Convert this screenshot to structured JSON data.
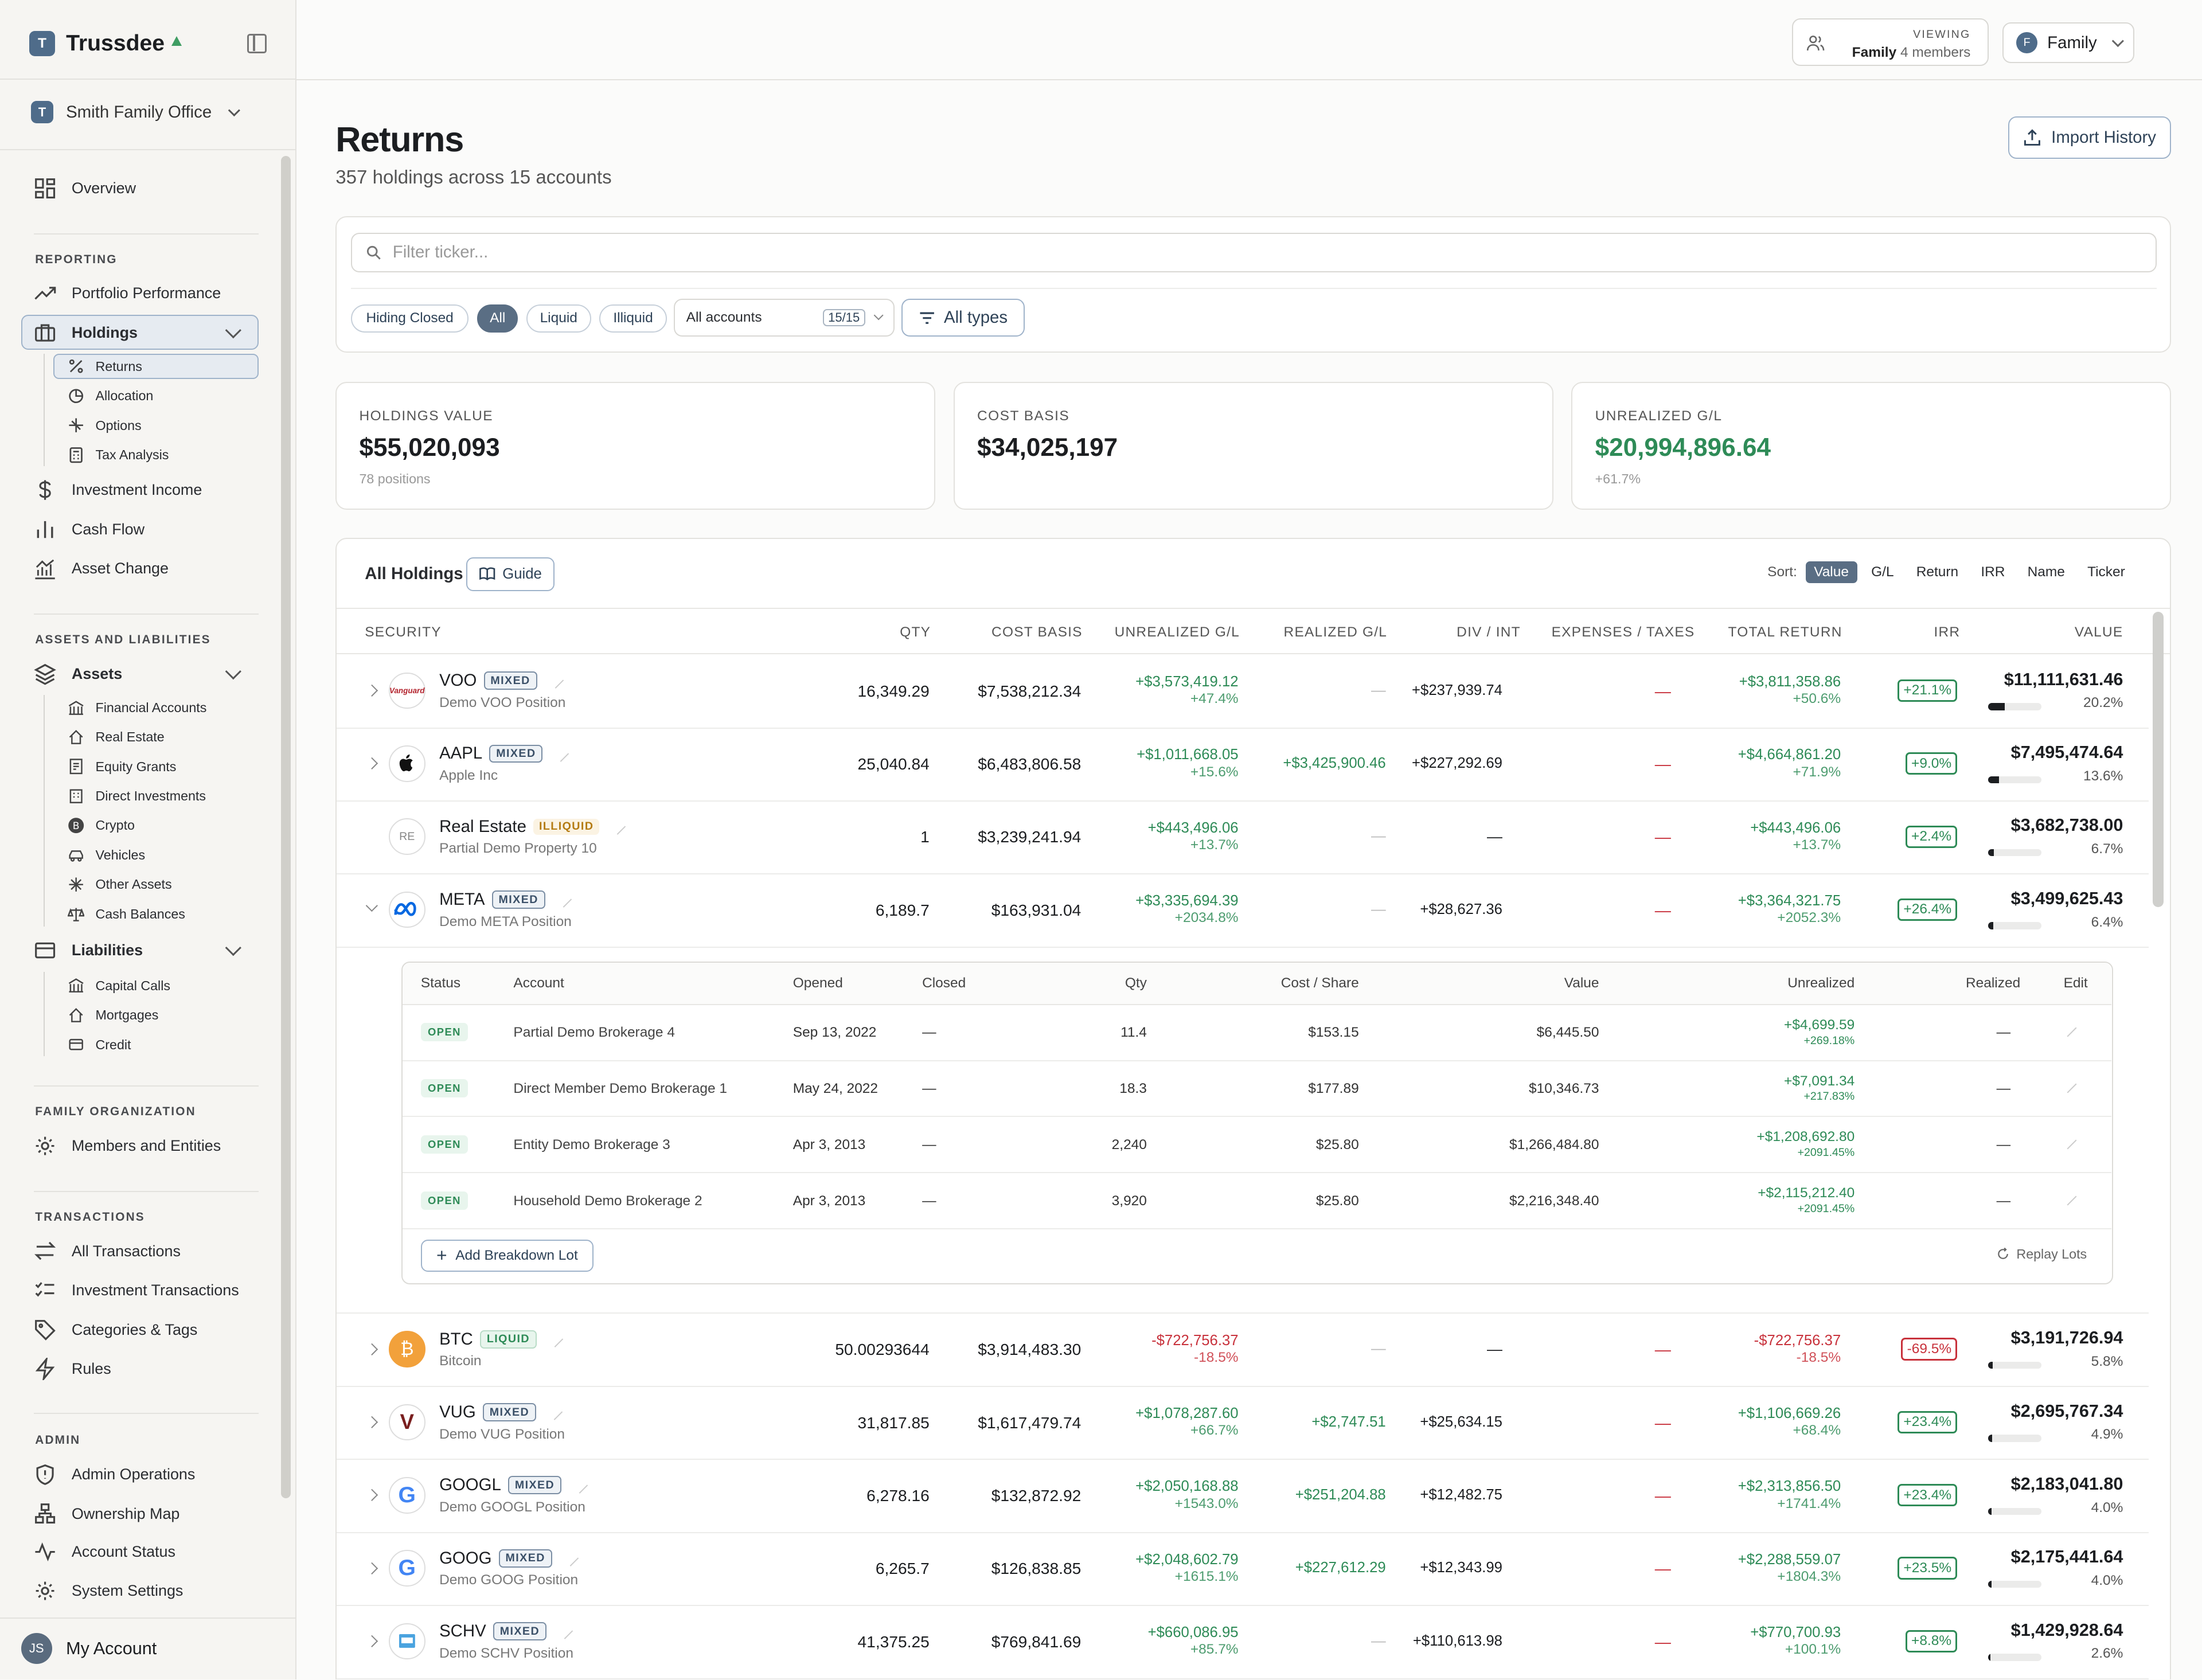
{
  "app": {
    "name": "Trussdee",
    "logo_letter": "T",
    "org": "Smith Family Office"
  },
  "sidebar": {
    "overview": "Overview",
    "reporting_label": "REPORTING",
    "portfolio_performance": "Portfolio Performance",
    "holdings": "Holdings",
    "holdings_sub": [
      "Returns",
      "Allocation",
      "Options",
      "Tax Analysis"
    ],
    "investment_income": "Investment Income",
    "cash_flow": "Cash Flow",
    "asset_change": "Asset Change",
    "al_label": "ASSETS AND LIABILITIES",
    "assets": "Assets",
    "assets_sub": [
      "Financial Accounts",
      "Real Estate",
      "Equity Grants",
      "Direct Investments",
      "Crypto",
      "Vehicles",
      "Other Assets",
      "Cash Balances"
    ],
    "liabilities": "Liabilities",
    "liabilities_sub": [
      "Capital Calls",
      "Mortgages",
      "Credit"
    ],
    "family_label": "FAMILY ORGANIZATION",
    "members": "Members and Entities",
    "tx_label": "TRANSACTIONS",
    "all_tx": "All Transactions",
    "inv_tx": "Investment Transactions",
    "cats": "Categories & Tags",
    "rules": "Rules",
    "admin_label": "ADMIN",
    "admin_ops": "Admin Operations",
    "ownership": "Ownership Map",
    "acct_status": "Account Status",
    "sys_settings": "System Settings",
    "account_initials": "JS",
    "account_name": "My Account"
  },
  "topbar": {
    "viewing_label": "VIEWING",
    "viewing_name": "Family",
    "viewing_members": "4 members",
    "family_btn": "Family",
    "family_initial": "F"
  },
  "page": {
    "title": "Returns",
    "subtitle": "357 holdings across 15 accounts",
    "import_btn": "Import History"
  },
  "filters": {
    "placeholder": "Filter ticker...",
    "hiding_closed": "Hiding Closed",
    "all": "All",
    "liquid": "Liquid",
    "illiquid": "Illiquid",
    "accounts": "All accounts",
    "accounts_count": "15/15",
    "types": "All types"
  },
  "stats": [
    {
      "label": "HOLDINGS VALUE",
      "value": "$55,020,093",
      "sub": "78 positions"
    },
    {
      "label": "COST BASIS",
      "value": "$34,025,197",
      "sub": ""
    },
    {
      "label": "UNREALIZED G/L",
      "value": "$20,994,896.64",
      "sub": "+61.7%"
    }
  ],
  "holdings": {
    "title": "All Holdings",
    "guide": "Guide",
    "sort_label": "Sort:",
    "sort_options": [
      "Value",
      "G/L",
      "Return",
      "IRR",
      "Name",
      "Ticker"
    ],
    "columns": [
      "SECURITY",
      "QTY",
      "COST BASIS",
      "UNREALIZED G/L",
      "REALIZED G/L",
      "DIV / INT",
      "EXPENSES / TAXES",
      "TOTAL RETURN",
      "IRR",
      "VALUE"
    ],
    "rows": [
      {
        "ticker": "VOO",
        "badge": "MIXED",
        "name": "Demo VOO Position",
        "qty": "16,349.29",
        "cost": "$7,538,212.34",
        "unr": "+$3,573,419.12",
        "unr_pct": "+47.4%",
        "real": "—",
        "div": "+$237,939.74",
        "exp": "—",
        "tr": "+$3,811,358.86",
        "tr_pct": "+50.6%",
        "irr": "+21.1%",
        "value": "$11,111,631.46",
        "weight_pct": 20.2,
        "weight": "20.2%",
        "logo": "Vanguard"
      },
      {
        "ticker": "AAPL",
        "badge": "MIXED",
        "name": "Apple Inc",
        "qty": "25,040.84",
        "cost": "$6,483,806.58",
        "unr": "+$1,011,668.05",
        "unr_pct": "+15.6%",
        "real": "+$3,425,900.46",
        "div": "+$227,292.69",
        "exp": "—",
        "tr": "+$4,664,861.20",
        "tr_pct": "+71.9%",
        "irr": "+9.0%",
        "value": "$7,495,474.64",
        "weight_pct": 13.6,
        "weight": "13.6%",
        "logo": ""
      },
      {
        "ticker": "Real Estate",
        "badge": "ILLIQUID",
        "name": "Partial Demo Property 10",
        "qty": "1",
        "cost": "$3,239,241.94",
        "unr": "+$443,496.06",
        "unr_pct": "+13.7%",
        "real": "—",
        "div": "—",
        "exp": "—",
        "tr": "+$443,496.06",
        "tr_pct": "+13.7%",
        "irr": "+2.4%",
        "value": "$3,682,738.00",
        "weight_pct": 6.7,
        "weight": "6.7%",
        "logo": "RE"
      },
      {
        "ticker": "META",
        "badge": "MIXED",
        "name": "Demo META Position",
        "qty": "6,189.7",
        "cost": "$163,931.04",
        "unr": "+$3,335,694.39",
        "unr_pct": "+2034.8%",
        "real": "—",
        "div": "+$28,627.36",
        "exp": "—",
        "tr": "+$3,364,321.75",
        "tr_pct": "+2052.3%",
        "irr": "+26.4%",
        "value": "$3,499,625.43",
        "weight_pct": 6.4,
        "weight": "6.4%",
        "logo": ""
      },
      {
        "ticker": "BTC",
        "badge": "LIQUID",
        "name": "Bitcoin",
        "qty": "50.00293644",
        "cost": "$3,914,483.30",
        "unr": "-$722,756.37",
        "unr_pct": "-18.5%",
        "real": "—",
        "div": "—",
        "exp": "—",
        "tr": "-$722,756.37",
        "tr_pct": "-18.5%",
        "irr": "-69.5%",
        "value": "$3,191,726.94",
        "weight_pct": 5.8,
        "weight": "5.8%",
        "logo": "₿"
      },
      {
        "ticker": "VUG",
        "badge": "MIXED",
        "name": "Demo VUG Position",
        "qty": "31,817.85",
        "cost": "$1,617,479.74",
        "unr": "+$1,078,287.60",
        "unr_pct": "+66.7%",
        "real": "+$2,747.51",
        "div": "+$25,634.15",
        "exp": "—",
        "tr": "+$1,106,669.26",
        "tr_pct": "+68.4%",
        "irr": "+23.4%",
        "value": "$2,695,767.34",
        "weight_pct": 4.9,
        "weight": "4.9%",
        "logo": "V"
      },
      {
        "ticker": "GOOGL",
        "badge": "MIXED",
        "name": "Demo GOOGL Position",
        "qty": "6,278.16",
        "cost": "$132,872.92",
        "unr": "+$2,050,168.88",
        "unr_pct": "+1543.0%",
        "real": "+$251,204.88",
        "div": "+$12,482.75",
        "exp": "—",
        "tr": "+$2,313,856.50",
        "tr_pct": "+1741.4%",
        "irr": "+23.4%",
        "value": "$2,183,041.80",
        "weight_pct": 4.0,
        "weight": "4.0%",
        "logo": "G"
      },
      {
        "ticker": "GOOG",
        "badge": "MIXED",
        "name": "Demo GOOG Position",
        "qty": "6,265.7",
        "cost": "$126,838.85",
        "unr": "+$2,048,602.79",
        "unr_pct": "+1615.1%",
        "real": "+$227,612.29",
        "div": "+$12,343.99",
        "exp": "—",
        "tr": "+$2,288,559.07",
        "tr_pct": "+1804.3%",
        "irr": "+23.5%",
        "value": "$2,175,441.64",
        "weight_pct": 4.0,
        "weight": "4.0%",
        "logo": "G"
      },
      {
        "ticker": "SCHV",
        "badge": "MIXED",
        "name": "Demo SCHV Position",
        "qty": "41,375.25",
        "cost": "$769,841.69",
        "unr": "+$660,086.95",
        "unr_pct": "+85.7%",
        "real": "—",
        "div": "+$110,613.98",
        "exp": "—",
        "tr": "+$770,700.93",
        "tr_pct": "+100.1%",
        "irr": "+8.8%",
        "value": "$1,429,928.64",
        "weight_pct": 2.6,
        "weight": "2.6%",
        "logo": ""
      }
    ]
  },
  "lots": {
    "columns": [
      "Status",
      "Account",
      "Opened",
      "Closed",
      "Qty",
      "Cost / Share",
      "Value",
      "Unrealized",
      "Realized",
      "Edit"
    ],
    "rows": [
      {
        "status": "OPEN",
        "account": "Partial Demo Brokerage 4",
        "opened": "Sep 13, 2022",
        "closed": "—",
        "qty": "11.4",
        "cps": "$153.15",
        "value": "$6,445.50",
        "unr": "+$4,699.59",
        "unr_pct": "+269.18%",
        "real": "—"
      },
      {
        "status": "OPEN",
        "account": "Direct Member Demo Brokerage 1",
        "opened": "May 24, 2022",
        "closed": "—",
        "qty": "18.3",
        "cps": "$177.89",
        "value": "$10,346.73",
        "unr": "+$7,091.34",
        "unr_pct": "+217.83%",
        "real": "—"
      },
      {
        "status": "OPEN",
        "account": "Entity Demo Brokerage 3",
        "opened": "Apr 3, 2013",
        "closed": "—",
        "qty": "2,240",
        "cps": "$25.80",
        "value": "$1,266,484.80",
        "unr": "+$1,208,692.80",
        "unr_pct": "+2091.45%",
        "real": "—"
      },
      {
        "status": "OPEN",
        "account": "Household Demo Brokerage 2",
        "opened": "Apr 3, 2013",
        "closed": "—",
        "qty": "3,920",
        "cps": "$25.80",
        "value": "$2,216,348.40",
        "unr": "+$2,115,212.40",
        "unr_pct": "+2091.45%",
        "real": "—"
      }
    ],
    "add_btn": "Add Breakdown Lot",
    "replay": "Replay Lots"
  }
}
